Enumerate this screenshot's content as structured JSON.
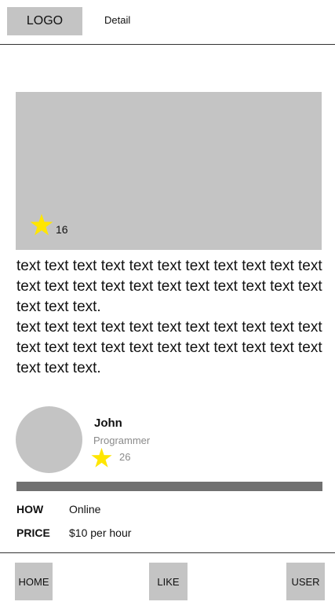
{
  "header": {
    "logo_label": "LOGO",
    "detail_label": "Detail"
  },
  "hero": {
    "icon": "star-icon",
    "star_count": "16"
  },
  "content": {
    "paragraphs": [
      "text text text text text text text text text text text text text text text text text text text text text text text text text.",
      "text text text text text text text text text text text text text text text text text text text text text text text text text."
    ]
  },
  "profile": {
    "name": "John",
    "role": "Programmer",
    "icon": "star-icon",
    "star_count": "26"
  },
  "info": {
    "how_label": "HOW",
    "how_value": "Online",
    "price_label": "PRICE",
    "price_value": "$10 per hour"
  },
  "nav": {
    "home_label": "HOME",
    "like_label": "LIKE",
    "user_label": "USER"
  },
  "colors": {
    "placeholder": "#c4c4c4",
    "star": "#ffe600",
    "bar": "#707070",
    "muted_text": "#8a8a8a"
  }
}
